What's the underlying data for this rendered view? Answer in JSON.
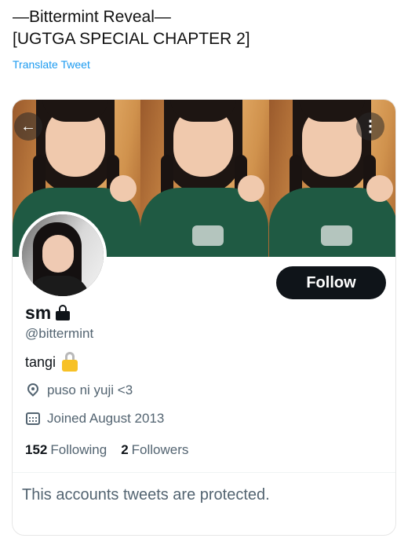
{
  "tweet": {
    "line1": "—Bittermint Reveal—",
    "line2": "[UGTGA SPECIAL CHAPTER 2]",
    "translate_label": "Translate Tweet"
  },
  "profile": {
    "display_name": "sm",
    "handle": "@bittermint",
    "bio": "tangi",
    "location": "puso ni yuji <3",
    "joined": "Joined August 2013",
    "following_count": "152",
    "following_label": "Following",
    "followers_count": "2",
    "followers_label": "Followers",
    "follow_button": "Follow",
    "protected_notice": "This accounts tweets are protected.",
    "back_glyph": "←",
    "more_glyph": "⋮"
  },
  "icons": [
    "back-arrow-icon",
    "more-options-icon",
    "lock-icon",
    "lock-emoji-icon",
    "location-pin-icon",
    "calendar-icon"
  ],
  "colors": {
    "link": "#1d9bf0",
    "follow_bg": "#0f1419",
    "secondary_text": "#536471",
    "shirt_green": "#1f5a43"
  }
}
